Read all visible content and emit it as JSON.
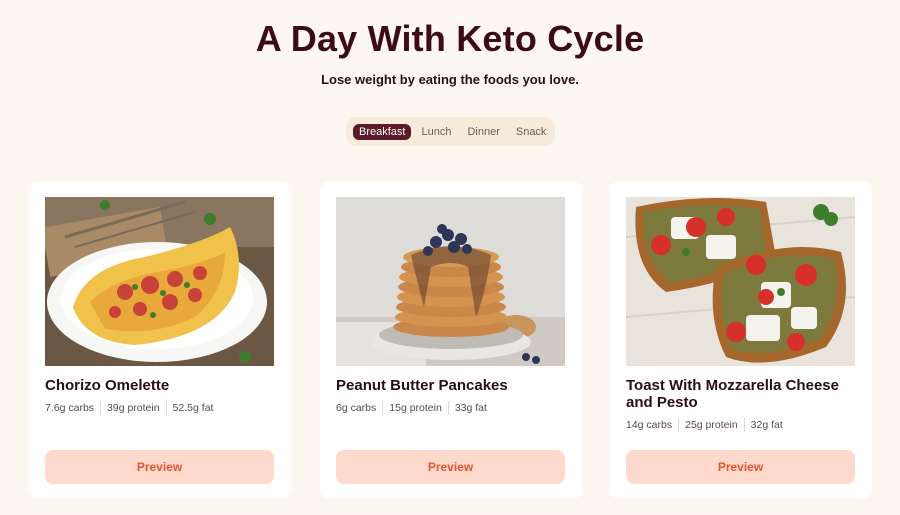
{
  "header": {
    "title": "A Day With Keto Cycle",
    "subtitle": "Lose weight by eating the foods you love."
  },
  "tabs": [
    {
      "label": "Breakfast",
      "active": true
    },
    {
      "label": "Lunch",
      "active": false
    },
    {
      "label": "Dinner",
      "active": false
    },
    {
      "label": "Snack",
      "active": false
    }
  ],
  "cards": [
    {
      "title": "Chorizo Omelette",
      "macros": [
        "7.6g carbs",
        "39g protein",
        "52.5g fat"
      ],
      "button_label": "Preview"
    },
    {
      "title": "Peanut Butter Pancakes",
      "macros": [
        "6g carbs",
        "15g protein",
        "33g fat"
      ],
      "button_label": "Preview"
    },
    {
      "title": "Toast With Mozzarella Cheese and Pesto",
      "macros": [
        "14g carbs",
        "25g protein",
        "32g fat"
      ],
      "button_label": "Preview"
    }
  ],
  "colors": {
    "background": "#fdf7f1",
    "title": "#3d0b16",
    "tab_active": "#5a1a2a",
    "button_bg": "#ffd9cc",
    "button_text": "#e2562f"
  }
}
